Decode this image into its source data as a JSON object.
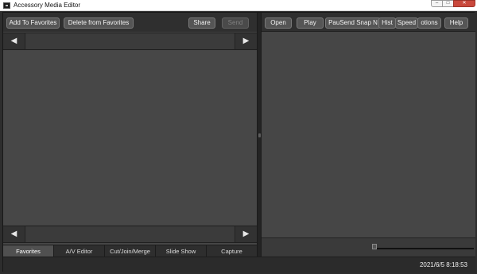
{
  "window": {
    "title": "Accessory Media Editor",
    "controls": {
      "minimize": "–",
      "maximize": "□",
      "close": "✕"
    }
  },
  "left_toolbar": {
    "add_favorites": "Add To Favorites",
    "delete_favorites": "Delete from Favorites",
    "share": "Share",
    "send": "Send"
  },
  "nav": {
    "prev": "◀",
    "next": "▶"
  },
  "right_toolbar": {
    "open": "Open",
    "play": "Play",
    "overlap_text": "PauSend Snap N",
    "hist": "Hist",
    "speed": "Speed",
    "options": "otions",
    "help": "Help"
  },
  "tabs": [
    "Favorites",
    "A/V Editor",
    "Cut/Join/Merge",
    "Slide Show",
    "Capture"
  ],
  "status": {
    "datetime": "2021/6/5 8:18:53"
  },
  "icons": {
    "app": "app-icon",
    "left_arrow": "left-arrow-icon",
    "right_arrow": "right-arrow-icon"
  },
  "colors": {
    "background": "#2d2d2d",
    "panel": "#464646",
    "toolbar": "#2f2f2f",
    "close_button": "#c9483c"
  }
}
